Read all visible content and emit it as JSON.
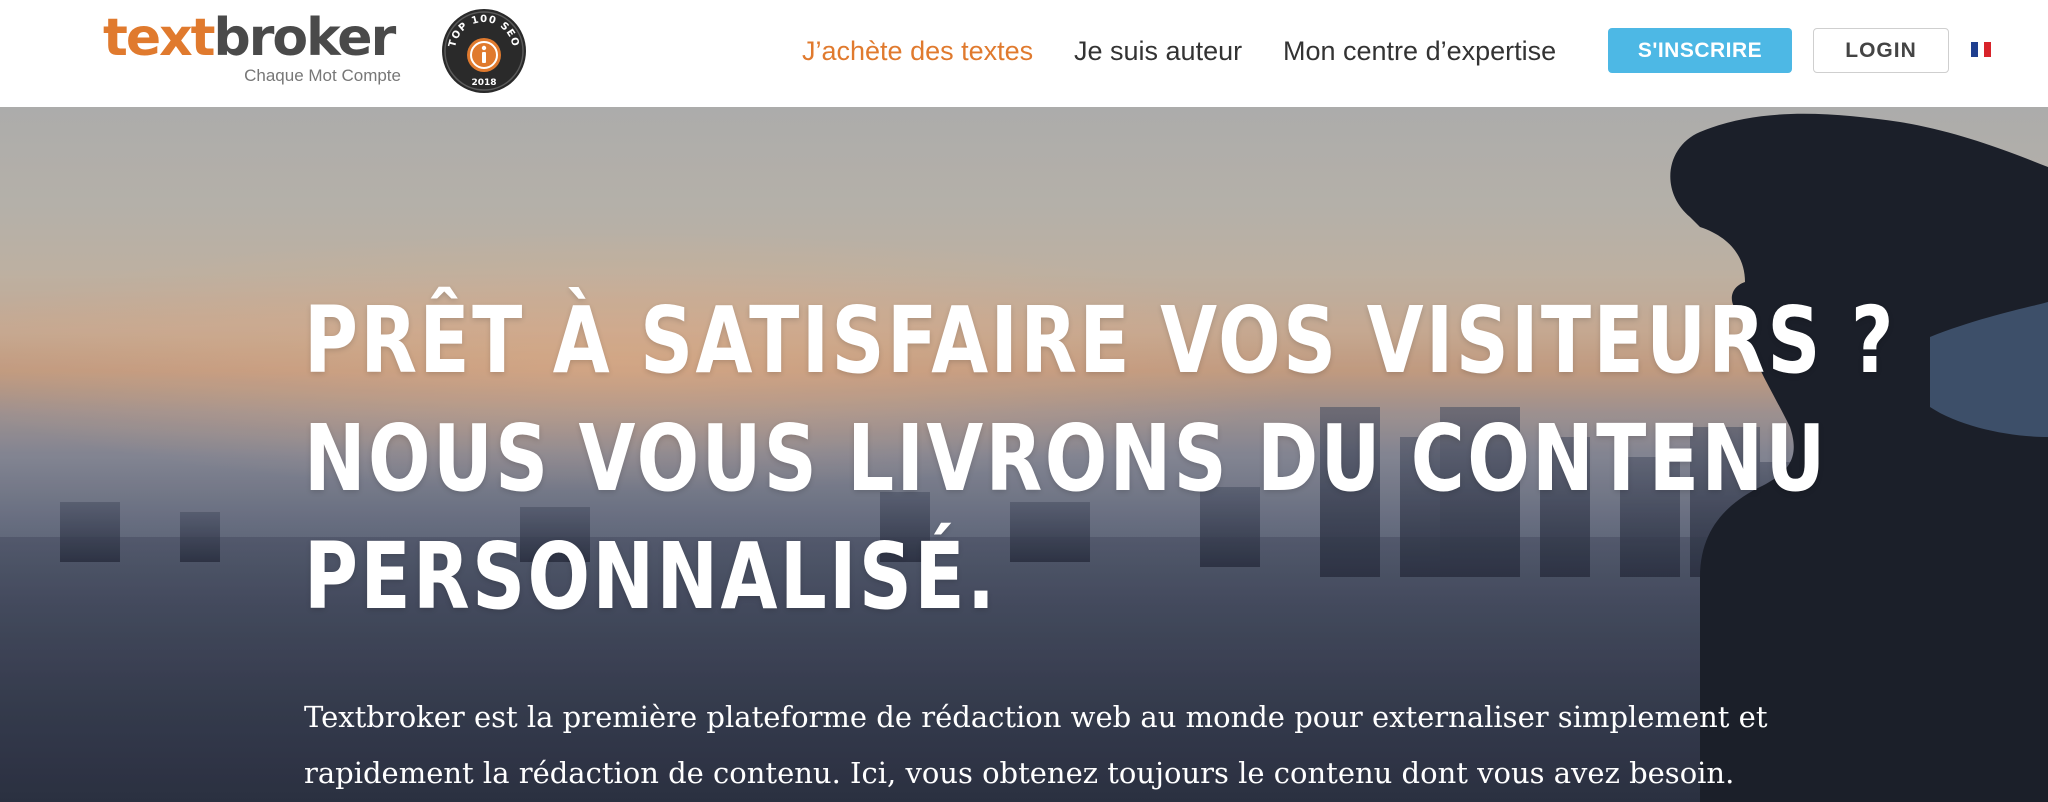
{
  "brand": {
    "logo_part1": "text",
    "logo_part2": "broker",
    "tagline": "Chaque Mot Compte",
    "logo_orange": "#e07a2e",
    "logo_gray": "#4a4a4a"
  },
  "seo_badge": {
    "top_text": "TOP 100 SEO",
    "year": "2018",
    "icon": "info-i-badge-icon"
  },
  "nav": {
    "items": [
      {
        "label": "J’achète des textes",
        "active": true
      },
      {
        "label": "Je suis auteur",
        "active": false
      },
      {
        "label": "Mon centre d’expertise",
        "active": false
      }
    ],
    "signup_label": "S'INSCRIRE",
    "login_label": "LOGIN",
    "language_flag": "france-flag-icon"
  },
  "hero": {
    "headline_lines": [
      "PRÊT À SATISFAIRE VOS VISITEURS ?",
      "NOUS VOUS LIVRONS DU CONTENU",
      "PERSONNALISÉ."
    ],
    "intro_lines": [
      "Textbroker est la première plateforme de rédaction web au monde pour externaliser simplement et",
      "rapidement la rédaction de contenu. Ici, vous obtenez toujours le contenu dont vous avez besoin."
    ]
  },
  "colors": {
    "accent_orange": "#e07a2e",
    "signup_blue": "#4db8e5",
    "nav_text": "#333333"
  }
}
